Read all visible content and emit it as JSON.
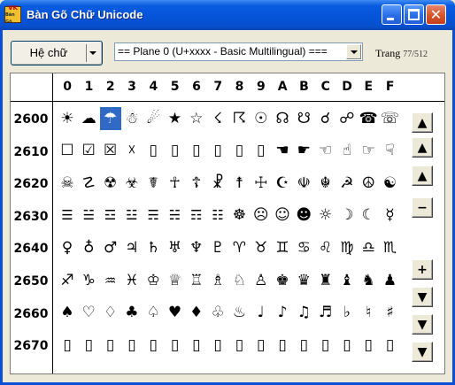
{
  "window": {
    "title": "Bàn Gõ Chữ Unicode",
    "icon_text": [
      "VK",
      "Bàn Gõ"
    ]
  },
  "toolbar": {
    "font_button_label": "Hệ chữ",
    "plane_select_value": "== Plane 0 (U+xxxx - Basic Multilingual) ===",
    "page_label": "Trang",
    "page_value": "77/512"
  },
  "grid": {
    "column_headers": [
      "0",
      "1",
      "2",
      "3",
      "4",
      "5",
      "6",
      "7",
      "8",
      "9",
      "A",
      "B",
      "C",
      "D",
      "E",
      "F"
    ],
    "selected_cell": "2602",
    "rows": [
      {
        "label": "2600",
        "chars": [
          "☀",
          "☁",
          "☂",
          "☃",
          "☄",
          "★",
          "☆",
          "☇",
          "☈",
          "☉",
          "☊",
          "☋",
          "☌",
          "☍",
          "☎",
          "☏"
        ]
      },
      {
        "label": "2610",
        "chars": [
          "☐",
          "☑",
          "☒",
          "☓",
          "▯",
          "▯",
          "▯",
          "▯",
          "▯",
          "▯",
          "☚",
          "☛",
          "☜",
          "☝",
          "☞",
          "☟"
        ]
      },
      {
        "label": "2620",
        "chars": [
          "☠",
          "☡",
          "☢",
          "☣",
          "☤",
          "☥",
          "☦",
          "☧",
          "☨",
          "☩",
          "☪",
          "☫",
          "☬",
          "☭",
          "☮",
          "☯"
        ]
      },
      {
        "label": "2630",
        "chars": [
          "☰",
          "☱",
          "☲",
          "☳",
          "☴",
          "☵",
          "☶",
          "☷",
          "☸",
          "☹",
          "☺",
          "☻",
          "☼",
          "☽",
          "☾",
          "☿"
        ]
      },
      {
        "label": "2640",
        "chars": [
          "♀",
          "♁",
          "♂",
          "♃",
          "♄",
          "♅",
          "♆",
          "♇",
          "♈",
          "♉",
          "♊",
          "♋",
          "♌",
          "♍",
          "♎",
          "♏"
        ]
      },
      {
        "label": "2650",
        "chars": [
          "♐",
          "♑",
          "♒",
          "♓",
          "♔",
          "♕",
          "♖",
          "♗",
          "♘",
          "♙",
          "♚",
          "♛",
          "♜",
          "♝",
          "♞",
          "♟"
        ]
      },
      {
        "label": "2660",
        "chars": [
          "♠",
          "♡",
          "♢",
          "♣",
          "♤",
          "♥",
          "♦",
          "♧",
          "♨",
          "♩",
          "♪",
          "♫",
          "♬",
          "♭",
          "♮",
          "♯"
        ]
      },
      {
        "label": "2670",
        "chars": [
          "▯",
          "▯",
          "▯",
          "▯",
          "▯",
          "▯",
          "▯",
          "▯",
          "▯",
          "▯",
          "▯",
          "▯",
          "▯",
          "▯",
          "▯",
          "▯"
        ]
      }
    ]
  },
  "scroll_buttons": [
    {
      "name": "page-up-icon",
      "symbol": "▲"
    },
    {
      "name": "row-up-icon",
      "symbol": "▲"
    },
    {
      "name": "line-up-icon",
      "symbol": "▲"
    },
    {
      "name": "zoom-out-icon",
      "symbol": "−"
    },
    {
      "name": "zoom-in-icon",
      "symbol": "+"
    },
    {
      "name": "line-down-icon",
      "symbol": "▼"
    },
    {
      "name": "row-down-icon",
      "symbol": "▼"
    },
    {
      "name": "page-down-icon",
      "symbol": "▼"
    }
  ],
  "colors": {
    "titlebar": "#0554d9",
    "selection": "#316ac5",
    "face": "#ece9d8"
  }
}
